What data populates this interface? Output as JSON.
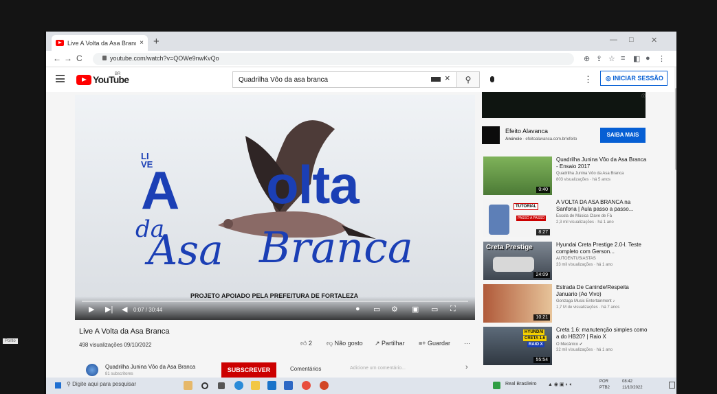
{
  "browser": {
    "tab_title": "Live A Volta da Asa Branca - YouT",
    "tab_close": "×",
    "new_tab": "+",
    "url": "youtube.com/watch?v=QOWe9nwKvQo"
  },
  "youtube": {
    "logo": "YouTube",
    "region": "BR",
    "search_value": "Quadrilha Vôo da asa branca",
    "clear_icon": "×",
    "sign_in": "INICIAR SESSÃO"
  },
  "video": {
    "thumb_li": "LI",
    "thumb_ve": "VE",
    "thumb_a": "A",
    "thumb_olta": "olta",
    "thumb_da": "da",
    "thumb_asa": "Asa",
    "thumb_branca": "Branca",
    "projeto": "PROJETO APOIADO PELA PREFEITURA DE FORTALEZA",
    "time": "0:07 / 30:44",
    "title": "Live A Volta da Asa Branca",
    "meta": "498 visualizações 09/10/2022",
    "likes": "2",
    "dislike": "Não gosto",
    "share": "Partilhar",
    "save": "Guardar",
    "more": "···"
  },
  "channel": {
    "name": "Quadrilha Junina Vôo da Asa Branca",
    "subs": "81 subscritores",
    "subscribe": "SUBSCREVER",
    "comments": "Comentários",
    "add_comment": "Adicione um comentário..."
  },
  "ad": {
    "title": "Efeito Alavanca",
    "label": "Anúncio",
    "sub": " · efeitoalavanca.com.br/efeito",
    "cta": "SAIBA MAIS",
    "marker": "ⓘ"
  },
  "recommendations": [
    {
      "title": "Quadrilha Junina Vôo da Asa Branca - Ensaio 2017",
      "channel": "Quadrilha Junina Vôo da Asa Branca",
      "views": "803 visualizações · há 5 anos",
      "duration": "0:40"
    },
    {
      "title": "A VOLTA DA ASA BRANCA na Sanfona | Aula passo a passo...",
      "channel": "Escola de Música Clave de Fá",
      "views": "2,3 mil visualizações · há 1 ano",
      "duration": "8:27",
      "thumb_badge": "TUTORIAL",
      "thumb_sub": "PASSO A PASSO"
    },
    {
      "title": "Hyundai Creta Prestige 2.0-l. Teste completo com Gerson...",
      "channel": "AUTOENTUSIASTAS",
      "views": "33 mil visualizações · há 1 ano",
      "duration": "24:09",
      "thumb_text": "Creta Prestige"
    },
    {
      "title": "Estrada De Caninde/Respeita Januario (Ao Vivo)",
      "channel": "Gonzaga Music Entertainment ♪",
      "views": "1,7 M de visualizações · há 7 anos",
      "duration": "10:21"
    },
    {
      "title": "Creta 1.6: manutenção simples como a do HB20? | Raio X",
      "channel": "O Mecânico ✔",
      "views": "32 mil visualizações · há 1 ano",
      "duration": "55:54",
      "thumb_l1": "HYUNDAI",
      "thumb_l2": "CRETA 1.6",
      "thumb_l3": "RAIO X"
    }
  ],
  "taskbar": {
    "search": "Digite aqui para pesquisar",
    "currency": "Real Brasileiro",
    "lang_top": "POR",
    "lang_bottom": "PTB2",
    "time": "08:42",
    "date": "11/10/2022",
    "sticker": "Ponto"
  }
}
